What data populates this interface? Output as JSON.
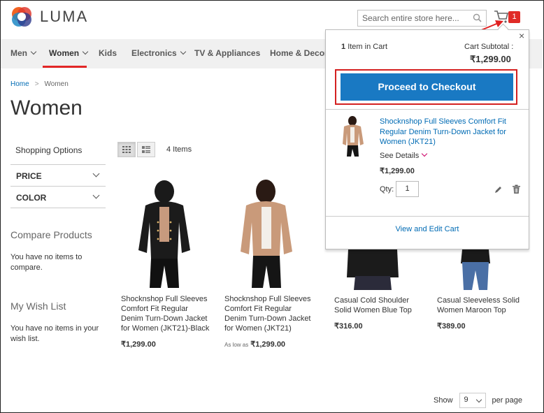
{
  "brand": {
    "name": "LUMA"
  },
  "search": {
    "placeholder": "Search entire store here..."
  },
  "cart": {
    "counter": "1"
  },
  "nav": {
    "items": [
      "Men",
      "Women",
      "Kids",
      "Electronics",
      "TV & Appliances",
      "Home & Decor"
    ]
  },
  "breadcrumb": {
    "home": "Home",
    "sep": ">",
    "current": "Women"
  },
  "page": {
    "title": "Women"
  },
  "sidebar": {
    "shopping_options": "Shopping Options",
    "filters": [
      "PRICE",
      "COLOR"
    ],
    "compare_title": "Compare Products",
    "compare_text": "You have no items to compare.",
    "wishlist_title": "My Wish List",
    "wishlist_text": "You have no items in your wish list."
  },
  "toolbar": {
    "items_count": "4 Items",
    "show_label": "Show",
    "limit": "9",
    "per_page": "per page"
  },
  "products": [
    {
      "name": "Shocknshop Full Sleeves Comfort Fit Regular Denim Turn-Down Jacket for Women (JKT21)-Black",
      "price": "₹1,299.00",
      "as_low_as": ""
    },
    {
      "name": "Shocknshop Full Sleeves Comfort Fit Regular Denim Turn-Down Jacket for Women (JKT21)",
      "price": "₹1,299.00",
      "as_low_as": "As low as"
    },
    {
      "name": "Casual Cold Shoulder Solid Women Blue Top",
      "price": "₹316.00",
      "as_low_as": ""
    },
    {
      "name": "Casual Sleeveless Solid Women Maroon Top",
      "price": "₹389.00",
      "as_low_as": ""
    }
  ],
  "minicart": {
    "close": "×",
    "count": "1",
    "count_label": "Item in Cart",
    "subtotal_label": "Cart Subtotal :",
    "subtotal": "₹1,299.00",
    "checkout": "Proceed to Checkout",
    "item_name": "Shocknshop Full Sleeves Comfort Fit Regular Denim Turn-Down Jacket for Women (JKT21)",
    "see_details": "See Details",
    "item_price": "₹1,299.00",
    "qty_label": "Qty:",
    "qty": "1",
    "view_edit": "View and Edit Cart"
  },
  "colors": {
    "accent": "#1979c3",
    "link": "#006bb4",
    "badge": "#e02b27",
    "annotation": "#d42020"
  }
}
